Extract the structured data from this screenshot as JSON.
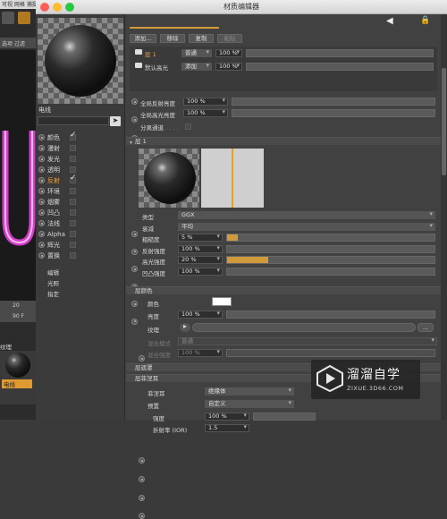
{
  "background_app": {
    "menu": "可视  网格  捕捉",
    "tabs": "选项  过滤",
    "ruler": "20",
    "frame": "90 F",
    "panel_label": "纹理",
    "material_label": "电线"
  },
  "window": {
    "title": "材质编辑器",
    "material_name": "电线",
    "channels": [
      {
        "label": "颜色",
        "checked": true
      },
      {
        "label": "漫射",
        "checked": false
      },
      {
        "label": "发光",
        "checked": false
      },
      {
        "label": "透明",
        "checked": false
      },
      {
        "label": "反射",
        "checked": true
      },
      {
        "label": "环境",
        "checked": false
      },
      {
        "label": "烟雾",
        "checked": false
      },
      {
        "label": "凹凸",
        "checked": false
      },
      {
        "label": "法线",
        "checked": false
      },
      {
        "label": "Alpha",
        "checked": false
      },
      {
        "label": "辉光",
        "checked": false
      },
      {
        "label": "置换",
        "checked": false
      }
    ],
    "extra_items": [
      "编辑",
      "光照",
      "指定"
    ]
  },
  "reflectance": {
    "buttons": {
      "add": "添加...",
      "remove": "移除",
      "copy": "复制",
      "paste": "粘贴"
    },
    "layers": [
      {
        "name": "层 1",
        "mode": "普通",
        "value": "100 %"
      },
      {
        "name": "默认高光",
        "mode": "添加",
        "value": "100 %"
      }
    ],
    "global_reflection": {
      "label": "全局反射亮度",
      "value": "100 %"
    },
    "global_specular": {
      "label": "全局高光亮度",
      "value": "100 %"
    },
    "separate_pass": {
      "label": "分离通道"
    },
    "layer_title": "层 1",
    "params": [
      {
        "label": "类型",
        "value": "GGX"
      },
      {
        "label": "衰减",
        "value": "平均"
      },
      {
        "label": "粗糙度",
        "value": "5 %",
        "fill": 0.05
      },
      {
        "label": "反射强度",
        "value": "100 %",
        "fill": 0.0
      },
      {
        "label": "高光强度",
        "value": "20 %",
        "fill": 0.2
      },
      {
        "label": "凹凸强度",
        "value": "100 %",
        "fill": 0.0
      }
    ],
    "layer_color": {
      "section": "层颜色",
      "color_label": "颜色",
      "brightness_label": "亮度",
      "brightness_value": "100 %",
      "texture_label": "纹理",
      "blend_mode_label": "混合模式",
      "blend_mode_value": "普通",
      "blend_strength_label": "混合强度",
      "blend_strength_value": "100 %"
    },
    "layer_mask": {
      "section": "层遮罩"
    },
    "layer_fresnel": {
      "section": "层菲涅耳",
      "fresnel_label": "菲涅耳",
      "fresnel_value": "绝缘体",
      "preset_label": "预置",
      "preset_value": "自定义",
      "strength_label": "强度",
      "strength_value": "100 %",
      "ior_label": "折射率 (IOR)",
      "ior_value": "1.5"
    }
  },
  "watermark": {
    "brand": "溜溜自学",
    "url": "ZIXUE.3D66.COM"
  },
  "colors": {
    "accent": "#d09a3a",
    "active_channel": "#f0a040"
  }
}
